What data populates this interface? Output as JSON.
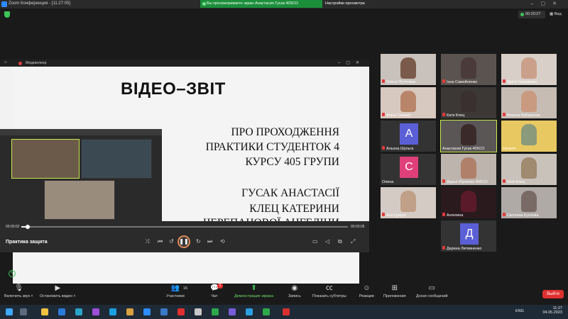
{
  "window": {
    "title": "Zoom Конференция - [11:27:05]"
  },
  "share_banner": {
    "message": "Вы просматриваете экран Анастасия Гусак 405СО",
    "options_label": "Настройки просмотра"
  },
  "meeting": {
    "elapsed": "00:20:27",
    "view_label": "Вид"
  },
  "player": {
    "app_title": "Медиаплеер",
    "clip_title": "Практика защита",
    "time_current": "00:00:02",
    "time_total": "00:03:05",
    "progress": 0.02
  },
  "slide": {
    "title": "ВІДЕО–ЗВІТ",
    "lines": [
      "ПРО ПРОХОДЖЕННЯ",
      "ПРАКТИКИ СТУДЕНТОК 4",
      "КУРСУ 405 ГРУПИ",
      "ГУСАК АНАСТАСІЇ",
      "КЛЕЦ КАТЕРИНИ",
      "ЧЕРЕПАНОВОЇ АНГЕЛІНИ"
    ]
  },
  "participants": [
    {
      "name": "Олеся Путятина",
      "muted": true
    },
    {
      "name": "Інна Самойленко",
      "muted": true
    },
    {
      "name": "Дар'я Середенко",
      "muted": true
    },
    {
      "name": "Аліна Синиця",
      "muted": true
    },
    {
      "name": "Катя Клец",
      "muted": true
    },
    {
      "name": "Альона Бабиненко",
      "muted": true
    },
    {
      "name": "Альона Шульга",
      "muted": true,
      "initial": "А",
      "color": "#5b5fd6"
    },
    {
      "name": "Анастасия Гусак 405СО",
      "muted": false,
      "active": true
    },
    {
      "name": "Наталя",
      "muted": false
    },
    {
      "name": "Олена",
      "muted": false,
      "initial": "С",
      "color": "#e0407a"
    },
    {
      "name": "Дарья Юрченко 405СО",
      "muted": true
    },
    {
      "name": "Катя Клец",
      "muted": true
    },
    {
      "name": "Аня Цукрук",
      "muted": true
    },
    {
      "name": "Ангелина",
      "muted": true
    },
    {
      "name": "Світлана Кухлова",
      "muted": true
    },
    {
      "name": "Дарина Литвиненко",
      "muted": true,
      "initial": "Д",
      "color": "#5b5fd6"
    }
  ],
  "toolbar": {
    "unmute": "Включить звук",
    "stop_video": "Остановить видео",
    "participants": "Участники",
    "participants_count": "16",
    "chat": "Чат",
    "chat_badge": "1",
    "share": "Демонстрация экрана",
    "record": "Запись",
    "captions": "Показать субтитры",
    "reactions": "Реакции",
    "apps": "Приложения",
    "whiteboard": "Доски сообщений",
    "end": "Выйти"
  },
  "taskbar": {
    "lang": "ENG",
    "time": "11:27",
    "date": "04.05.2023"
  }
}
